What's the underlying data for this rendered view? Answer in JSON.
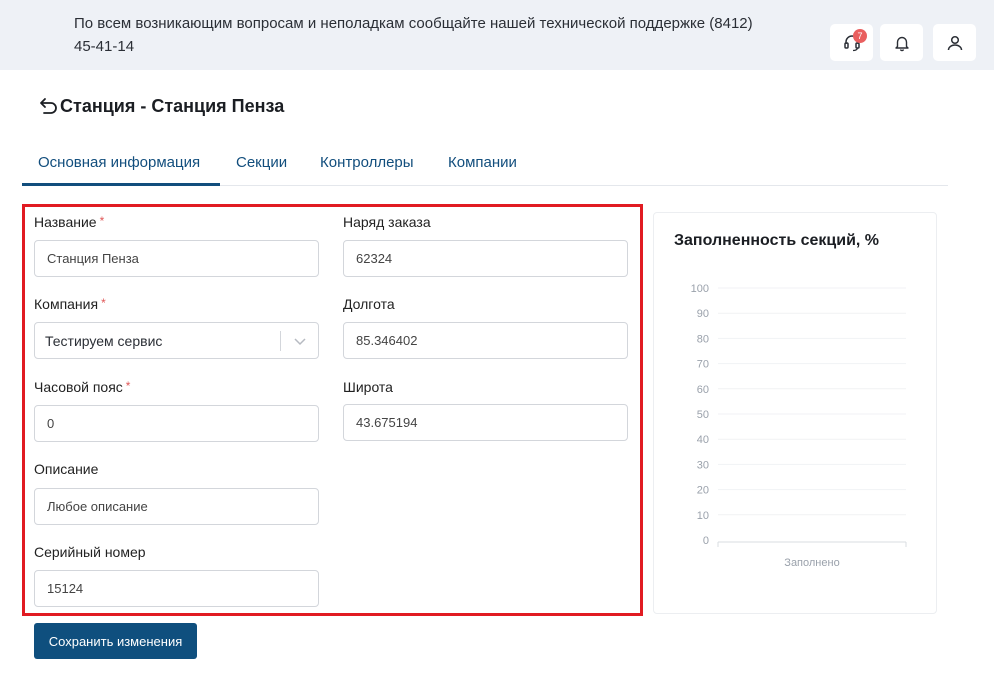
{
  "topbar": {
    "notice": "По всем возникающим вопросам и неполадкам сообщайте нашей технической поддержке (8412) 45-41-14",
    "support_badge": "7",
    "icons": [
      "headset-icon",
      "bell-icon",
      "user-icon"
    ]
  },
  "header": {
    "title": "Станция - Станция Пенза",
    "back_icon": "back-arrow-icon"
  },
  "tabs": [
    {
      "label": "Основная информация",
      "active": true
    },
    {
      "label": "Секции",
      "active": false
    },
    {
      "label": "Контроллеры",
      "active": false
    },
    {
      "label": "Компании",
      "active": false
    }
  ],
  "form": {
    "name": {
      "label": "Название",
      "required": "*",
      "value": "Станция Пенза"
    },
    "company": {
      "label": "Компания",
      "required": "*",
      "value": "Тестируем сервис"
    },
    "timezone": {
      "label": "Часовой пояс",
      "required": "*",
      "value": "0"
    },
    "description": {
      "label": "Описание",
      "value": "Любое описание"
    },
    "serial": {
      "label": "Серийный номер",
      "value": "15124"
    },
    "order": {
      "label": "Наряд заказа",
      "value": "62324"
    },
    "longitude": {
      "label": "Долгота",
      "value": "85.346402"
    },
    "latitude": {
      "label": "Широта",
      "value": "43.675194"
    }
  },
  "actions": {
    "save_label": "Сохранить изменения"
  },
  "colors": {
    "accent": "#0f4f7e",
    "highlight_border": "#e11b22",
    "badge": "#e95f5f",
    "topbar_bg": "#eef1f6"
  },
  "chart_data": {
    "type": "bar",
    "title": "Заполненность секций, %",
    "categories": [
      "Заполнено"
    ],
    "values": [],
    "ylim": [
      0,
      100
    ],
    "yticks": [
      0,
      10,
      20,
      30,
      40,
      50,
      60,
      70,
      80,
      90,
      100
    ],
    "grid": true
  }
}
